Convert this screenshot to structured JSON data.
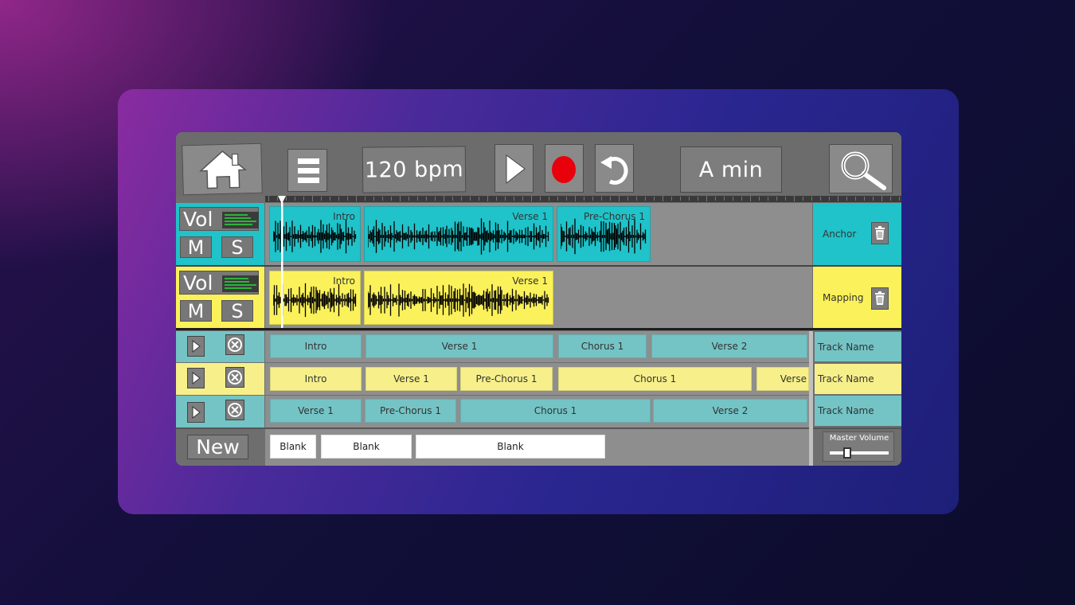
{
  "toolbar": {
    "home_icon": "house-icon",
    "menu_icon": "hamburger-icon",
    "tempo": "120 bpm",
    "play_icon": "play-icon",
    "record_icon": "record-icon",
    "undo_icon": "undo-icon",
    "key": "A min",
    "search_icon": "search-icon"
  },
  "colors": {
    "teal": "#1fc3c9",
    "yellow": "#fbf15a",
    "record": "#e8000b"
  },
  "tracks": [
    {
      "vol_label": "Vol",
      "mute_label": "M",
      "solo_label": "S",
      "name": "Anchor",
      "color": "#1fc3c9",
      "clips": [
        "Intro",
        "Verse 1",
        "Pre-Chorus 1"
      ]
    },
    {
      "vol_label": "Vol",
      "mute_label": "M",
      "solo_label": "S",
      "name": "Mapping",
      "color": "#fbf15a",
      "clips": [
        "Intro",
        "Verse 1"
      ]
    }
  ],
  "arrangements": [
    {
      "color": "teal",
      "track_name": "Track Name",
      "sections": [
        "Intro",
        "Verse 1",
        "Chorus 1",
        "Verse 2"
      ]
    },
    {
      "color": "yellow",
      "track_name": "Track Name",
      "sections": [
        "Intro",
        "Verse 1",
        "Pre-Chorus 1",
        "Chorus 1",
        "Verse"
      ]
    },
    {
      "color": "teal",
      "track_name": "Track Name",
      "sections": [
        "Verse 1",
        "Pre-Chorus 1",
        "Chorus 1",
        "Verse 2"
      ]
    }
  ],
  "new_row": {
    "new_label": "New",
    "blanks": [
      "Blank",
      "Blank",
      "Blank"
    ]
  },
  "master_volume": {
    "label": "Master Volume",
    "level": 0.3
  }
}
